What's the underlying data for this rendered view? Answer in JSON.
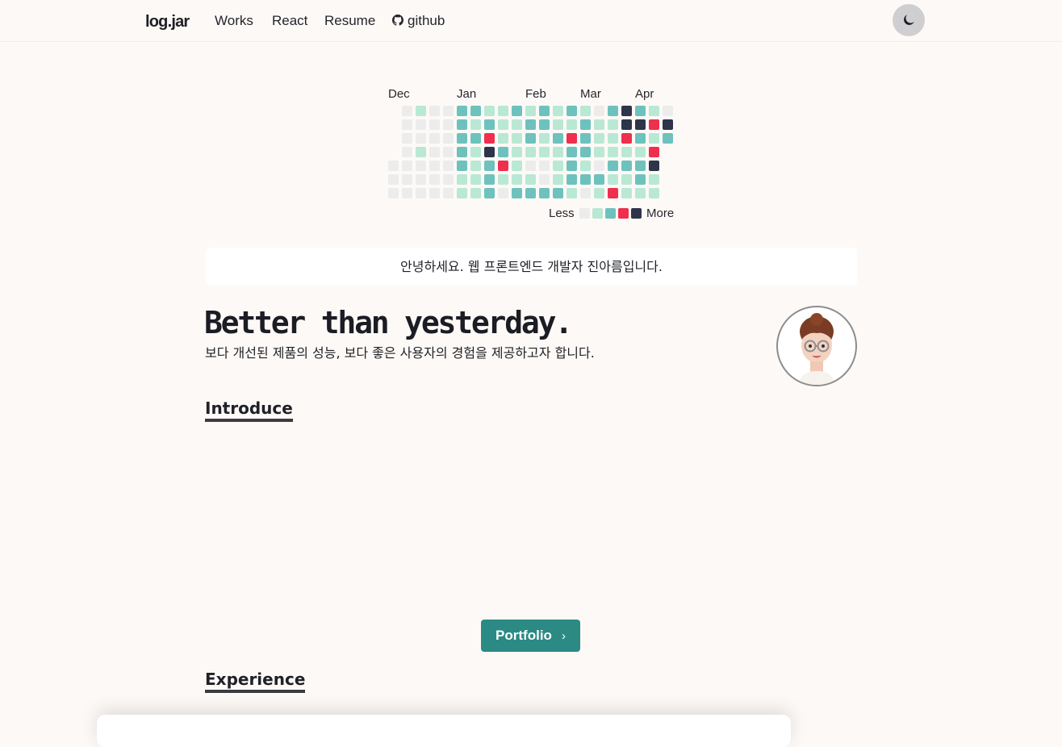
{
  "header": {
    "brand": "log.jar",
    "nav": [
      "Works",
      "React",
      "Resume",
      "github"
    ],
    "theme_icon": "moon-icon",
    "github_icon": "github-icon"
  },
  "contributions": {
    "months": [
      "Dec",
      "Jan",
      "Feb",
      "Mar",
      "Apr"
    ],
    "legend_less": "Less",
    "legend_more": "More",
    "palette": [
      "#ececec",
      "#b9e8d5",
      "#6ec2bd",
      "#ee2f4d",
      "#2e3449"
    ],
    "weeks": [
      [
        null,
        null,
        null,
        null,
        0,
        0,
        0
      ],
      [
        0,
        0,
        0,
        0,
        0,
        0,
        0
      ],
      [
        1,
        0,
        0,
        1,
        0,
        0,
        0
      ],
      [
        0,
        0,
        0,
        0,
        0,
        0,
        0
      ],
      [
        0,
        0,
        0,
        0,
        0,
        0,
        0
      ],
      [
        2,
        2,
        2,
        2,
        2,
        1,
        1
      ],
      [
        2,
        1,
        2,
        1,
        1,
        1,
        1
      ],
      [
        1,
        2,
        3,
        4,
        2,
        2,
        2
      ],
      [
        1,
        1,
        1,
        2,
        3,
        1,
        0
      ],
      [
        2,
        1,
        1,
        1,
        1,
        1,
        2
      ],
      [
        1,
        2,
        2,
        1,
        0,
        1,
        2
      ],
      [
        2,
        2,
        1,
        1,
        0,
        0,
        2
      ],
      [
        1,
        1,
        2,
        1,
        1,
        1,
        2
      ],
      [
        2,
        1,
        3,
        2,
        2,
        2,
        1
      ],
      [
        1,
        2,
        2,
        2,
        1,
        2,
        0
      ],
      [
        0,
        1,
        1,
        1,
        0,
        2,
        1
      ],
      [
        2,
        1,
        1,
        1,
        2,
        1,
        3
      ],
      [
        4,
        4,
        3,
        1,
        2,
        1,
        1
      ],
      [
        2,
        4,
        2,
        1,
        2,
        2,
        1
      ],
      [
        1,
        3,
        1,
        3,
        4,
        1,
        1
      ],
      [
        0,
        4,
        2,
        null,
        null,
        null,
        null
      ]
    ]
  },
  "greeting": "안녕하세요. 웹 프론트엔드 개발자 진아름입니다.",
  "hero": {
    "title": "Better than yesterday.",
    "subtitle": "보다 개선된 제품의 성능, 보다 좋은 사용자의 경험을 제공하고자 합니다.",
    "avatar_icon": "memoji-avatar"
  },
  "sections": {
    "introduce": "Introduce",
    "experience": "Experience"
  },
  "portfolio_button": "Portfolio",
  "accent_color": "#2b8a84"
}
